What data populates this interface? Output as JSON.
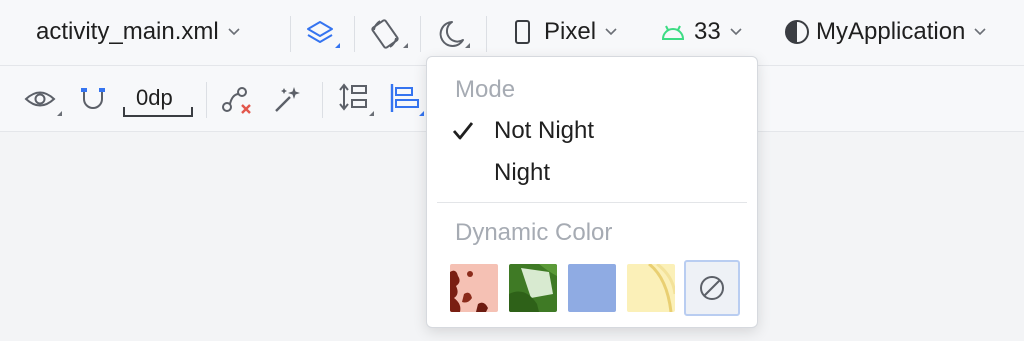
{
  "toolbar": {
    "layout_file": "activity_main.xml",
    "device": "Pixel",
    "api_level": "33",
    "app_theme": "MyApplication"
  },
  "design_toolbar": {
    "default_margin": "0dp"
  },
  "night_mode_menu": {
    "mode_header": "Mode",
    "items": [
      {
        "label": "Not Night",
        "selected": true
      },
      {
        "label": "Night",
        "selected": false
      }
    ],
    "dynamic_color_header": "Dynamic Color",
    "swatches": [
      {
        "name": "red-wallpaper",
        "base": "#f5c1b4",
        "accent": "#7a1f12"
      },
      {
        "name": "green-wallpaper",
        "base": "#d8ead0",
        "accent": "#3f7a25"
      },
      {
        "name": "blue-wallpaper",
        "base": "#8fabe3"
      },
      {
        "name": "yellow-wallpaper",
        "base": "#fbf0b8",
        "accent": "#e9cf72"
      },
      {
        "name": "no-dynamic-color",
        "selected": true
      }
    ]
  },
  "colors": {
    "accent_blue": "#3574f0",
    "android_green": "#3ddc84",
    "muted_text": "#a6abb3"
  }
}
